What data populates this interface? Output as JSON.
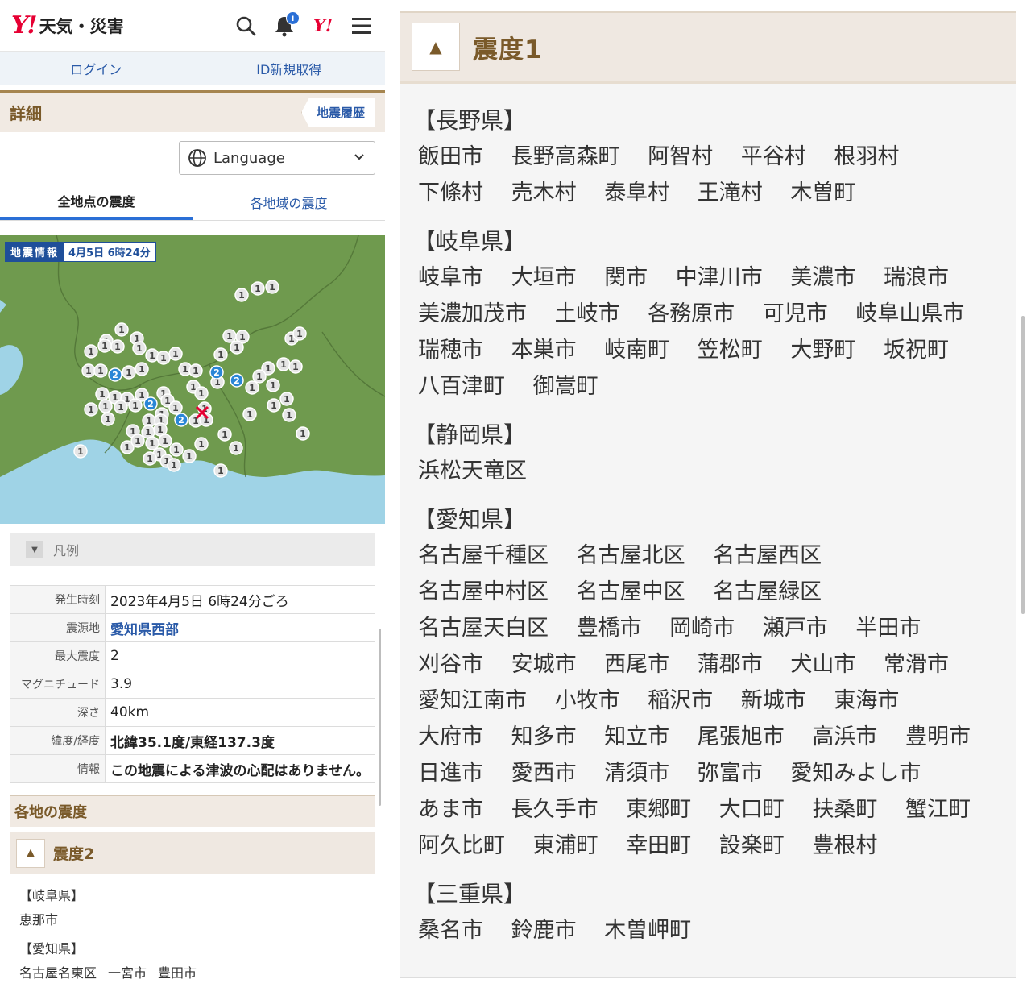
{
  "header": {
    "logo_mark": "Y!",
    "logo_text": "天気・災害",
    "notification_badge": "i",
    "y_icon": "Y!",
    "icons": [
      "search-icon",
      "bell-icon",
      "yahoo-icon",
      "menu-icon"
    ]
  },
  "auth": {
    "login": "ログイン",
    "signup": "ID新規取得"
  },
  "detail": {
    "title": "詳細",
    "history_button": "地震履歴"
  },
  "language": {
    "label": "Language"
  },
  "tabs": [
    {
      "label": "全地点の震度",
      "active": true
    },
    {
      "label": "各地域の震度",
      "active": false
    }
  ],
  "map": {
    "badge_title": "地震情報",
    "badge_time": "4月5日 6時24分",
    "markers_blue_label": "2",
    "markers_gray_label": "1"
  },
  "legend": {
    "label": "凡例"
  },
  "info": [
    {
      "key": "発生時刻",
      "value": "2023年4月5日 6時24分ごろ",
      "style": ""
    },
    {
      "key": "震源地",
      "value": "愛知県西部",
      "style": "link"
    },
    {
      "key": "最大震度",
      "value": "2",
      "style": ""
    },
    {
      "key": "マグニチュード",
      "value": "3.9",
      "style": ""
    },
    {
      "key": "深さ",
      "value": "40km",
      "style": ""
    },
    {
      "key": "緯度/経度",
      "value": "北緯35.1度/東経137.3度",
      "style": "bold"
    },
    {
      "key": "情報",
      "value": "この地震による津波の心配はありません。",
      "style": "bold"
    }
  ],
  "regional": {
    "title": "各地の震度",
    "shindo2": {
      "label": "震度2",
      "groups": [
        {
          "pref": "【岐阜県】",
          "places": [
            "恵那市"
          ]
        },
        {
          "pref": "【愛知県】",
          "places": [
            "名古屋名東区",
            "一宮市",
            "豊田市"
          ]
        }
      ]
    }
  },
  "shindo1": {
    "label": "震度1",
    "groups": [
      {
        "pref": "【長野県】",
        "places": [
          "飯田市",
          "長野高森町",
          "阿智村",
          "平谷村",
          "根羽村",
          "下條村",
          "売木村",
          "泰阜村",
          "王滝村",
          "木曽町"
        ]
      },
      {
        "pref": "【岐阜県】",
        "places": [
          "岐阜市",
          "大垣市",
          "関市",
          "中津川市",
          "美濃市",
          "瑞浪市",
          "美濃加茂市",
          "土岐市",
          "各務原市",
          "可児市",
          "岐阜山県市",
          "瑞穂市",
          "本巣市",
          "岐南町",
          "笠松町",
          "大野町",
          "坂祝町",
          "八百津町",
          "御嵩町"
        ]
      },
      {
        "pref": "【静岡県】",
        "places": [
          "浜松天竜区"
        ]
      },
      {
        "pref": "【愛知県】",
        "places": [
          "名古屋千種区",
          "名古屋北区",
          "名古屋西区",
          "名古屋中村区",
          "名古屋中区",
          "名古屋緑区",
          "名古屋天白区",
          "豊橋市",
          "岡崎市",
          "瀬戸市",
          "半田市",
          "刈谷市",
          "安城市",
          "西尾市",
          "蒲郡市",
          "犬山市",
          "常滑市",
          "愛知江南市",
          "小牧市",
          "稲沢市",
          "新城市",
          "東海市",
          "大府市",
          "知多市",
          "知立市",
          "尾張旭市",
          "高浜市",
          "豊明市",
          "日進市",
          "愛西市",
          "清須市",
          "弥富市",
          "愛知みよし市",
          "あま市",
          "長久手市",
          "東郷町",
          "大口町",
          "扶桑町",
          "蟹江町",
          "阿久比町",
          "東浦町",
          "幸田町",
          "設楽町",
          "豊根村"
        ]
      },
      {
        "pref": "【三重県】",
        "places": [
          "桑名市",
          "鈴鹿市",
          "木曽岬町"
        ]
      }
    ]
  },
  "colors": {
    "accent_brown": "#7a5a2a",
    "link_blue": "#2a5aa8",
    "land": "#6f9a4e",
    "sea": "#9fd3e6",
    "brand_red": "#e60033"
  }
}
